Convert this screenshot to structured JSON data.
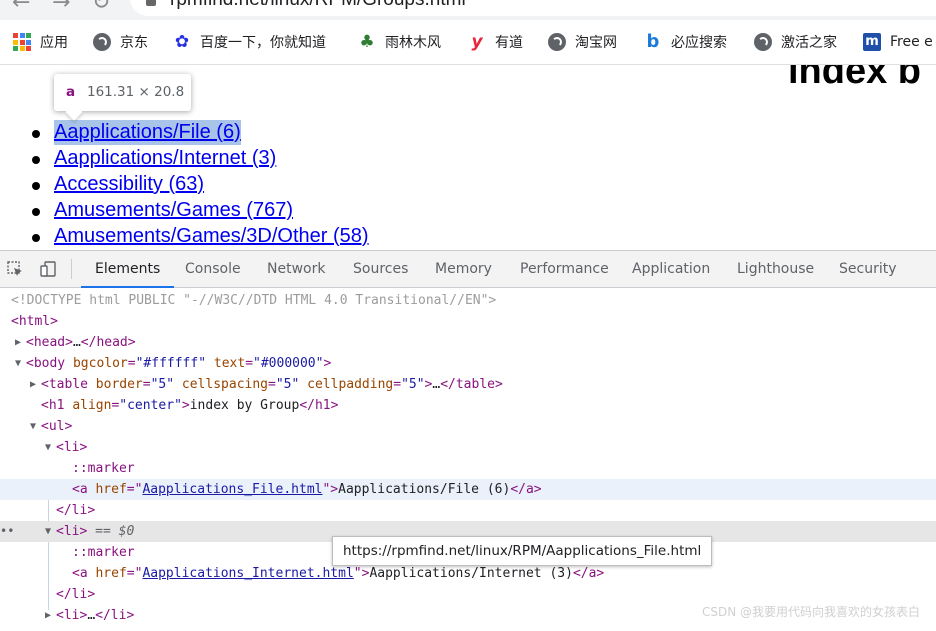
{
  "browser": {
    "url": "rpmfind.net/linux/RPM/Groups.html"
  },
  "bookmarks": [
    {
      "label": "应用",
      "icon": "apps-icon"
    },
    {
      "label": "京东",
      "icon": "globe-icon"
    },
    {
      "label": "百度一下，你就知道",
      "icon": "baidu-paw-icon"
    },
    {
      "label": "雨林木风",
      "icon": "tree-icon"
    },
    {
      "label": "有道",
      "icon": "youdao-icon"
    },
    {
      "label": "淘宝网",
      "icon": "globe-icon"
    },
    {
      "label": "必应搜索",
      "icon": "bing-icon"
    },
    {
      "label": "激活之家",
      "icon": "globe-icon"
    },
    {
      "label": "Free e",
      "icon": "mm-icon"
    }
  ],
  "page": {
    "heading": "index b",
    "links": [
      "Aapplications/File (6)",
      "Aapplications/Internet (3)",
      "Accessibility (63)",
      "Amusements/Games (767)",
      "Amusements/Games/3D/Other (58)"
    ],
    "hover_tip": {
      "tag": "a",
      "dims": "161.31 × 20.8"
    }
  },
  "devtools": {
    "tabs": [
      "Elements",
      "Console",
      "Network",
      "Sources",
      "Memory",
      "Performance",
      "Application",
      "Lighthouse",
      "Security"
    ],
    "active_tab": "Elements",
    "dom": {
      "doctype": "<!DOCTYPE html PUBLIC \"-//W3C//DTD HTML 4.0 Transitional//EN\">",
      "html": "html",
      "head": "head",
      "ellipsis": "…",
      "body": {
        "tag": "body",
        "attr1": "bgcolor",
        "val1": "\"#ffffff\"",
        "attr2": "text",
        "val2": "\"#000000\""
      },
      "table": {
        "tag": "table",
        "attr1": "border",
        "val1": "\"5\"",
        "attr2": "cellspacing",
        "val2": "\"5\"",
        "attr3": "cellpadding",
        "val3": "\"5\""
      },
      "h1": {
        "tag": "h1",
        "attr": "align",
        "val": "\"center\"",
        "text": "index by Group"
      },
      "ul": "ul",
      "li": "li",
      "marker": "::marker",
      "a1": {
        "attr": "href",
        "val": "Aapplications_File.html",
        "text": "Aapplications/File (6)"
      },
      "a2": {
        "attr": "href",
        "val": "Aapplications_Internet.html",
        "text": "Aapplications/Internet (3)"
      },
      "selected_suffix": "== $0"
    },
    "url_tooltip": "https://rpmfind.net/linux/RPM/Aapplications_File.html"
  },
  "watermark": "CSDN @我要用代码向我喜欢的女孩表白"
}
